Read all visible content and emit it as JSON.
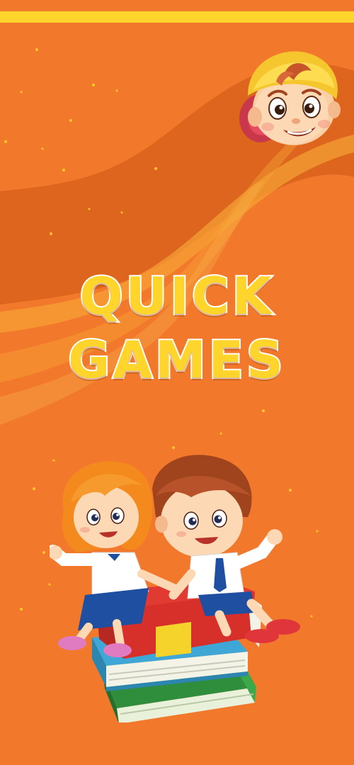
{
  "title": {
    "line1": "QUICK",
    "line2": "GAMES"
  },
  "colors": {
    "background": "#F2792C",
    "wave_dark": "#D9621C",
    "wave_light": "#F7A234",
    "title_fill": "#FFD52B",
    "title_outline": "#FFFFFF",
    "top_bar": "#FFD52B"
  },
  "illustrations": {
    "header_character": "cartoon-boy-cap-icon",
    "hero_image": "kids-on-books-illustration"
  }
}
